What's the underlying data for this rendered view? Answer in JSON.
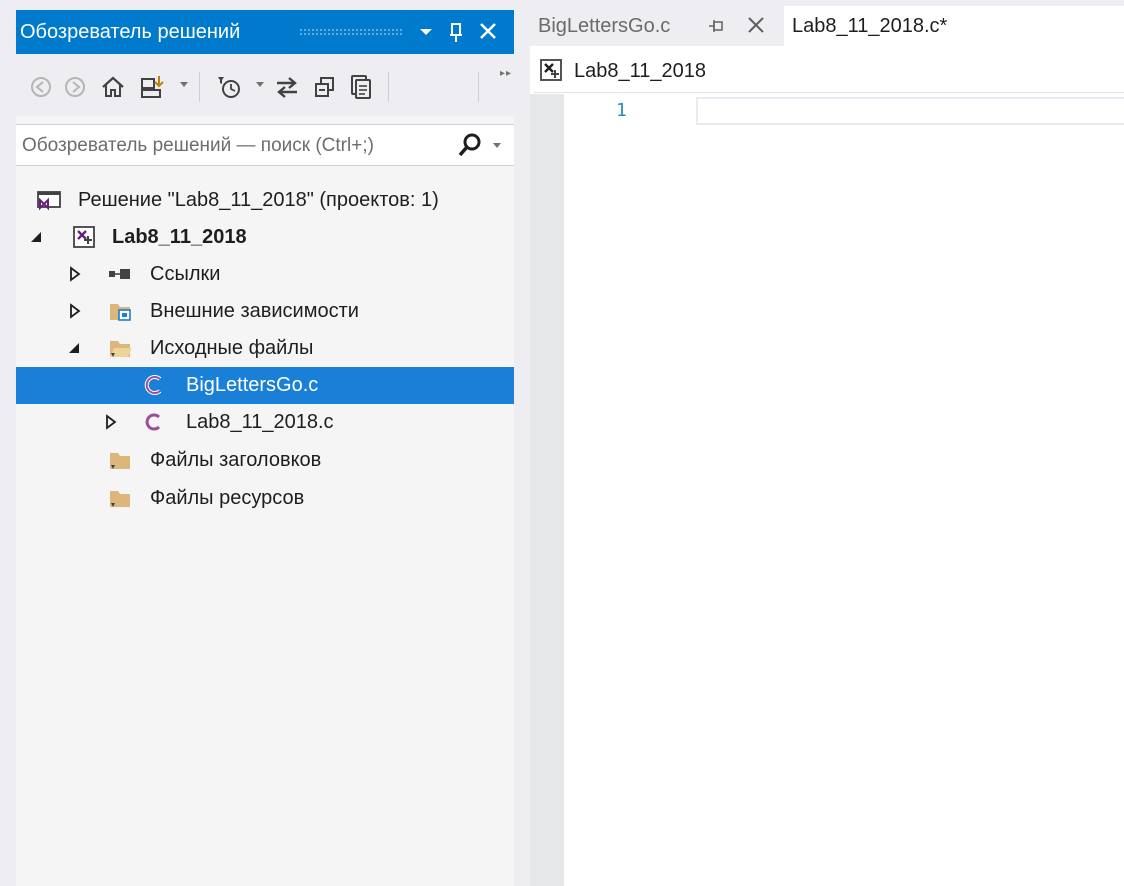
{
  "solution_explorer": {
    "title": "Обозреватель решений",
    "search_placeholder": "Обозреватель решений — поиск (Ctrl+;)",
    "tree": {
      "solution_label": "Решение \"Lab8_11_2018\"  (проектов: 1)",
      "project_label": "Lab8_11_2018",
      "references_label": "Ссылки",
      "external_deps_label": "Внешние зависимости",
      "source_files_label": "Исходные файлы",
      "file_biglettersgo": "BigLettersGo.c",
      "file_lab8": "Lab8_11_2018.c",
      "header_files_label": "Файлы заголовков",
      "resource_files_label": "Файлы ресурсов"
    }
  },
  "editor": {
    "tabs": [
      {
        "label": "BigLettersGo.c"
      },
      {
        "label": "Lab8_11_2018.c*"
      }
    ],
    "nav_project": "Lab8_11_2018",
    "line_numbers": [
      "1"
    ]
  },
  "colors": {
    "accent": "#007acc",
    "selection": "#1a7fd6",
    "c_file_icon": "#9b4f96",
    "folder": "#dcb67a",
    "line_number": "#2b91af"
  }
}
